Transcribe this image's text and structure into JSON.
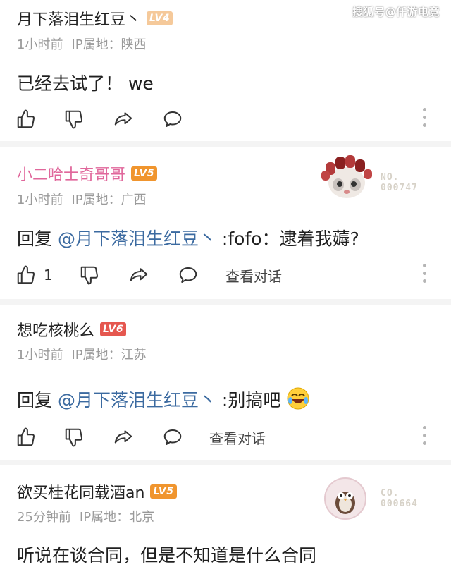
{
  "watermark": "搜狐号@仟游电竞",
  "colors": {
    "mention": "#3b6aa0",
    "pink_name": "#e0679b",
    "badge_lv4": "#f5c99a",
    "badge_lv5": "#f0952e",
    "badge_lv6": "#e5574f"
  },
  "icons": [
    "thumb-up-icon",
    "thumb-down-icon",
    "share-icon",
    "chat-bubble-icon",
    "more-vertical-icon"
  ],
  "comments": [
    {
      "user": "月下落泪生红豆丶",
      "level": "LV4",
      "time": "1小时前",
      "ip": "IP属地：陕西",
      "text": "已经去试了！ we"
    },
    {
      "user": "小二哈士奇哥哥",
      "level": "LV5",
      "time": "1小时前",
      "ip": "IP属地：广西",
      "reply_prefix": "回复",
      "mention": "@月下落泪生红豆丶",
      "text": " :fofo：逮着我薅?",
      "likes": "1",
      "view_conversation": "查看对话",
      "card_no_label": "NO.",
      "card_no_value": "000747"
    },
    {
      "user": "想吃核桃么",
      "level": "LV6",
      "time": "1小时前",
      "ip": "IP属地：江苏",
      "reply_prefix": "回复",
      "mention": "@月下落泪生红豆丶",
      "text": " :别搞吧",
      "view_conversation": "查看对话"
    },
    {
      "user": "欲买桂花同载酒an",
      "level": "LV5",
      "time": "25分钟前",
      "ip": "IP属地：北京",
      "text": "听说在谈合同，但是不知道是什么合同",
      "card_no_label": "CO.",
      "card_no_value": "000664"
    }
  ]
}
